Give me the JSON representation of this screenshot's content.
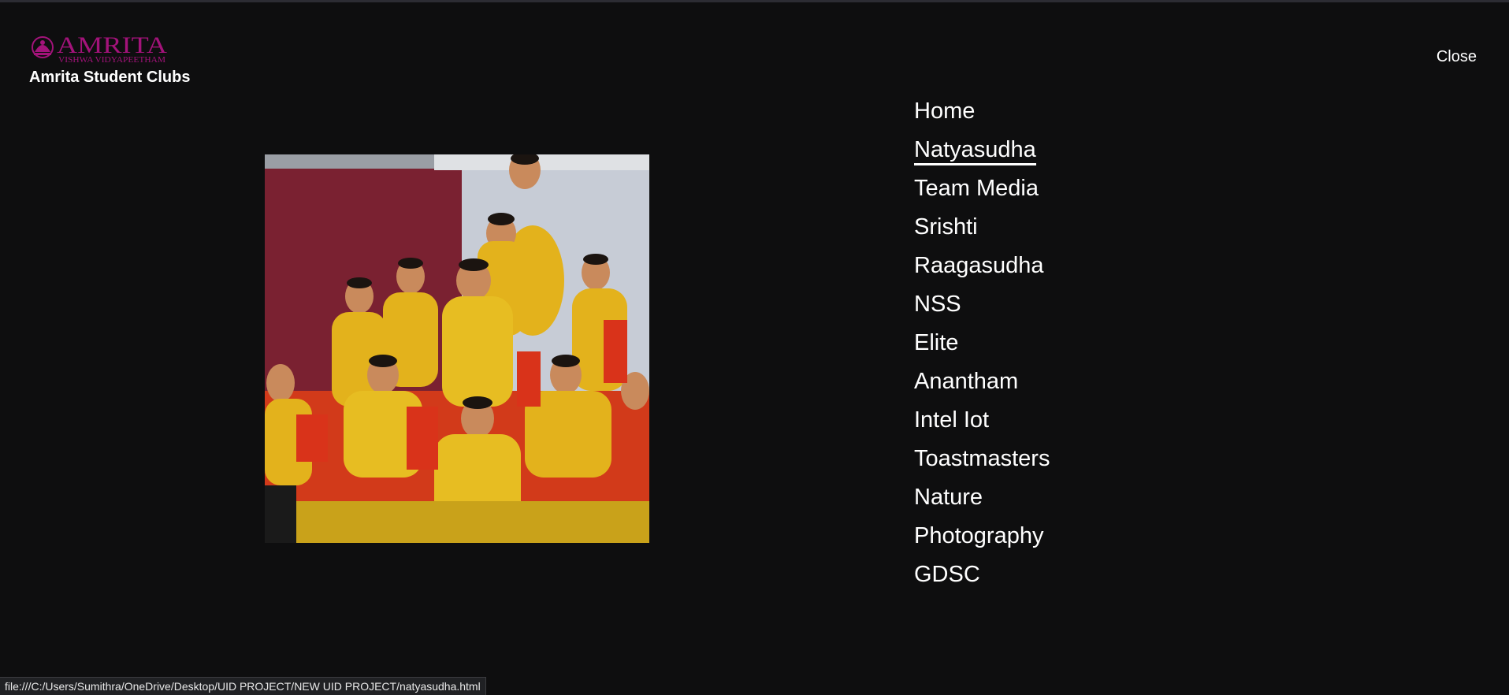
{
  "branding": {
    "logo_text": "AMRITA",
    "logo_subtext": "VISHWA VIDYAPEETHAM",
    "logo_color": "#a3137a",
    "site_title": "Amrita Student Clubs"
  },
  "header": {
    "close_label": "Close"
  },
  "hero": {
    "image_icon": "dance-group-photo"
  },
  "nav": {
    "active_index": 1,
    "items": [
      {
        "label": "Home"
      },
      {
        "label": "Natyasudha"
      },
      {
        "label": "Team Media"
      },
      {
        "label": "Srishti"
      },
      {
        "label": "Raagasudha"
      },
      {
        "label": "NSS"
      },
      {
        "label": "Elite"
      },
      {
        "label": "Anantham"
      },
      {
        "label": "Intel Iot"
      },
      {
        "label": "Toastmasters"
      },
      {
        "label": "Nature"
      },
      {
        "label": "Photography"
      },
      {
        "label": "GDSC"
      }
    ]
  },
  "status_bar": {
    "url": "file:///C:/Users/Sumithra/OneDrive/Desktop/UID PROJECT/NEW UID PROJECT/natyasudha.html"
  }
}
